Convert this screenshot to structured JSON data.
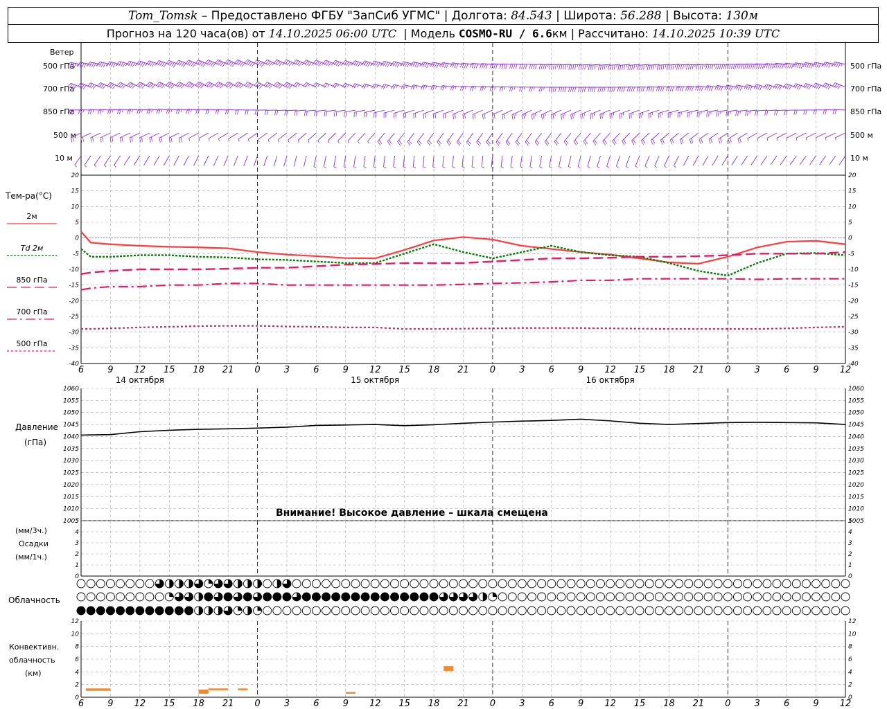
{
  "header": {
    "station": "Tom_Tomsk",
    "provider": " – Предоставлено ФГБУ \"ЗапСиб УГМС\" | Долгота: ",
    "lon": "84.543",
    "lat_label": " | Широта: ",
    "lat": "56.288",
    "alt_label": " | Высота: ",
    "alt": "130м",
    "forecast_label": "Прогноз на 120 часа(ов) от ",
    "forecast_from": "14.10.2025 06:00 UTC",
    "model_label": "  | Модель ",
    "model": "COSMO-RU / 6.6",
    "model_unit": "км",
    "calc_label": " | Рассчитано: ",
    "calc": "14.10.2025 10:39 UTC"
  },
  "colors": {
    "wind": "#8a2be2",
    "t2m": "#ff3b3b",
    "td2m": "#008000",
    "t850": "#e6196b",
    "t700": "#e6196b",
    "t500": "#e6196b",
    "pressure": "#000000",
    "conv": "#f08a2c"
  },
  "wind_panel": {
    "title": "Ветер",
    "levels": [
      "500 гПа",
      "700 гПа",
      "850 гПа",
      "500 м",
      "10 м"
    ]
  },
  "temp_panel": {
    "title": "Тем-ра(°С)",
    "legend": [
      {
        "label": "2м",
        "style": "solid"
      },
      {
        "label": "Td  2м",
        "style": "dotted"
      },
      {
        "label": "850 гПа",
        "style": "solid"
      },
      {
        "label": "700 гПа",
        "style": "dashdot"
      },
      {
        "label": "500 гПа",
        "style": "dashed"
      }
    ],
    "yticks": [
      "20",
      "15",
      "10",
      "5",
      "0",
      "-5",
      "-10",
      "-15",
      "-20",
      "-25",
      "-30",
      "-35",
      "-40"
    ]
  },
  "pressure_panel": {
    "title": "Давление",
    "unit": "(гПа)",
    "warning": "Внимание! Высокое давление – шкала смещена",
    "yticks": [
      "1060",
      "1055",
      "1050",
      "1045",
      "1040",
      "1035",
      "1030",
      "1025",
      "1020",
      "1015",
      "1010",
      "1005"
    ]
  },
  "precip_panel": {
    "unit3": "(мм/3ч.)",
    "title": "Осадки",
    "unit1": "(мм/1ч.)",
    "yticks": [
      "5",
      "4",
      "3",
      "2",
      "1",
      "0"
    ]
  },
  "cloud_panel": {
    "title": "Облачность"
  },
  "conv_panel": {
    "title1": "Конвективн.",
    "title2": "облачность",
    "unit": "(км)",
    "yticks": [
      "12",
      "10",
      "8",
      "6",
      "4",
      "2",
      "0"
    ]
  },
  "x_axis": {
    "hour_labels": [
      "6",
      "9",
      "12",
      "15",
      "18",
      "21",
      "0",
      "3",
      "6",
      "9",
      "12",
      "15",
      "18",
      "21",
      "0",
      "3",
      "6",
      "9",
      "12",
      "15",
      "18",
      "21",
      "0",
      "3",
      "6",
      "9",
      "12"
    ],
    "dates": [
      "14 октября",
      "15 октября",
      "16 октября"
    ]
  },
  "chart_data": [
    {
      "type": "line",
      "title": "Тем-ра(°С)",
      "x_hours_from_start": [
        0,
        1,
        3,
        6,
        9,
        12,
        15,
        18,
        21,
        24,
        27,
        30,
        33,
        36,
        39,
        42,
        45,
        48,
        51,
        54,
        57,
        60,
        63,
        66,
        69,
        72,
        75,
        78
      ],
      "series": [
        {
          "name": "2м",
          "values": [
            2,
            -1.5,
            -2,
            -2.5,
            -2.8,
            -3,
            -3.3,
            -4.5,
            -5.3,
            -5.8,
            -6.4,
            -6.5,
            -3.8,
            -0.8,
            0.3,
            -0.5,
            -2.5,
            -3.5,
            -4.5,
            -5.3,
            -6.5,
            -7.8,
            -8.2,
            -6,
            -3,
            -1.2,
            -0.9,
            -2
          ]
        },
        {
          "name": "Td  2м",
          "values": [
            -3.5,
            -6,
            -6,
            -5.5,
            -5.5,
            -6,
            -6.2,
            -6.8,
            -7,
            -7.5,
            -8,
            -8,
            -5,
            -2,
            -4.5,
            -6.5,
            -4.5,
            -2.5,
            -4.5,
            -5.5,
            -6,
            -8,
            -10.5,
            -12,
            -8,
            -5,
            -4.8,
            -5.5
          ]
        },
        {
          "name": "850 гПа",
          "values": [
            -11.5,
            -11,
            -10.5,
            -10,
            -10,
            -10,
            -9.8,
            -9.5,
            -9.5,
            -9,
            -8.5,
            -8.3,
            -8,
            -8,
            -8,
            -7.5,
            -7,
            -6.5,
            -6.5,
            -6.3,
            -6,
            -6,
            -5.8,
            -5.5,
            -5,
            -5,
            -5,
            -4.5
          ]
        },
        {
          "name": "700 гПа",
          "values": [
            -16.5,
            -16,
            -15.5,
            -15.5,
            -15,
            -15,
            -14.5,
            -14.5,
            -15,
            -15,
            -15,
            -15,
            -15,
            -15,
            -14.8,
            -14.5,
            -14.3,
            -14,
            -13.5,
            -13.5,
            -13,
            -13,
            -13,
            -13,
            -13.2,
            -13,
            -13,
            -13
          ]
        },
        {
          "name": "500 гПа",
          "values": [
            -29,
            -29,
            -28.8,
            -28.5,
            -28.3,
            -28.1,
            -28,
            -28,
            -28.2,
            -28.3,
            -28.5,
            -28.5,
            -29,
            -29,
            -28.9,
            -28.8,
            -28.7,
            -28.7,
            -28.7,
            -28.8,
            -28.9,
            -29,
            -29,
            -29,
            -29,
            -28.8,
            -28.5,
            -28.3
          ]
        }
      ],
      "xlabel": "",
      "ylabel": "Тем-ра(°С)",
      "ylim": [
        -40,
        20
      ]
    },
    {
      "type": "line",
      "title": "Давление",
      "x_hours_from_start": [
        0,
        3,
        6,
        9,
        12,
        15,
        18,
        21,
        24,
        27,
        30,
        33,
        36,
        39,
        42,
        45,
        48,
        51,
        54,
        57,
        60,
        63,
        66,
        69,
        72,
        75,
        78
      ],
      "series": [
        {
          "name": "Давление",
          "values": [
            1040.6,
            1040.8,
            1042.0,
            1042.6,
            1043.0,
            1043.2,
            1043.5,
            1043.9,
            1044.6,
            1044.8,
            1045.0,
            1044.5,
            1044.9,
            1045.5,
            1046.0,
            1046.4,
            1046.7,
            1047.2,
            1046.5,
            1045.5,
            1045.0,
            1045.4,
            1045.8,
            1045.9,
            1045.8,
            1045.7,
            1045.0
          ]
        }
      ],
      "ylabel": "(гПа)",
      "ylim": [
        1005,
        1060
      ]
    },
    {
      "type": "bar",
      "title": "Конвективн. облачность",
      "series": [
        {
          "name": "base_top_km",
          "values": [
            {
              "h0": 0.5,
              "h1": 3,
              "bottom": 1.1,
              "top": 1.5
            },
            {
              "h0": 12,
              "h1": 13,
              "bottom": 0.6,
              "top": 1.3
            },
            {
              "h0": 13,
              "h1": 15,
              "bottom": 1.2,
              "top": 1.5
            },
            {
              "h0": 16,
              "h1": 17,
              "bottom": 1.2,
              "top": 1.5
            },
            {
              "h0": 27,
              "h1": 28,
              "bottom": 0.6,
              "top": 0.9
            },
            {
              "h0": 37,
              "h1": 38,
              "bottom": 4.5,
              "top": 5.3
            }
          ]
        }
      ],
      "ylabel": "(км)",
      "ylim": [
        0,
        13
      ]
    },
    {
      "type": "table",
      "title": "Облачность",
      "rows": [
        {
          "name": "row_upper",
          "hours_from_start": [
            8,
            9,
            10,
            11,
            12,
            13,
            14,
            15,
            16,
            17,
            18,
            20,
            21
          ],
          "fractions": [
            0.75,
            0.5,
            0.5,
            0.5,
            0.75,
            0.25,
            0.75,
            0.75,
            0.5,
            0.5,
            0.5,
            0.5,
            0.75
          ]
        },
        {
          "name": "row_middle",
          "hours_from_start": [
            9,
            10,
            11,
            12,
            13,
            14,
            15,
            16,
            17,
            18,
            19,
            20,
            21,
            22,
            23,
            24,
            25,
            26,
            27,
            28,
            29,
            30,
            31,
            32,
            33,
            34,
            35,
            36,
            37,
            38,
            39,
            40,
            41,
            42
          ],
          "fractions": [
            0.25,
            0.75,
            0.75,
            0.5,
            1,
            0.75,
            1,
            0.75,
            1,
            0.75,
            1,
            1,
            1,
            0.75,
            1,
            1,
            1,
            1,
            1,
            1,
            1,
            1,
            1,
            1,
            1,
            1,
            1,
            1,
            0.75,
            0.75,
            0.75,
            0.75,
            0.5,
            0.25
          ]
        },
        {
          "name": "row_lower",
          "hours_from_start": [
            0,
            1,
            2,
            3,
            4,
            5,
            6,
            7,
            8,
            9,
            10,
            11,
            12,
            13,
            14,
            15,
            16,
            17,
            18
          ],
          "fractions": [
            1,
            1,
            1,
            1,
            1,
            1,
            1,
            1,
            1,
            1,
            1,
            1,
            0.5,
            0.5,
            0.5,
            0.75,
            0.25,
            0.5,
            0.25
          ]
        }
      ]
    },
    {
      "type": "scatter",
      "title": "Ветер",
      "levels": [
        "500 гПа",
        "700 гПа",
        "850 гПа",
        "500 м",
        "10 м"
      ],
      "approx_direction_deg": [
        280,
        285,
        260,
        230,
        200
      ],
      "approx_speed_ms": [
        25,
        18,
        12,
        9,
        4
      ]
    }
  ]
}
